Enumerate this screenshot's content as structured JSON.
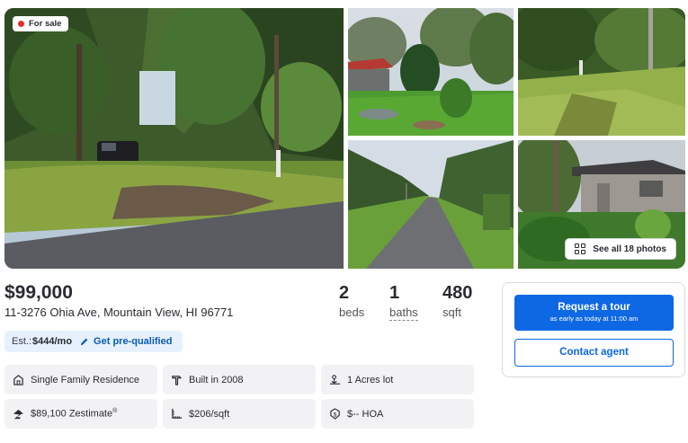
{
  "listing": {
    "status_badge": "For sale",
    "see_all_photos": "See all 18 photos",
    "price": "$99,000",
    "address": "11-3276 Ohia Ave, Mountain View, HI 96771",
    "beds": {
      "value": "2",
      "label": "beds"
    },
    "baths": {
      "value": "1",
      "label": "baths"
    },
    "sqft": {
      "value": "480",
      "label": "sqft"
    }
  },
  "estimate": {
    "prefix": "Est.:",
    "monthly": "$444/mo",
    "prequal_label": "Get pre-qualified"
  },
  "facts": [
    {
      "icon": "house-icon",
      "text": "Single Family Residence"
    },
    {
      "icon": "hammer-icon",
      "text": "Built in 2008"
    },
    {
      "icon": "lot-icon",
      "text": "1 Acres lot"
    },
    {
      "icon": "zestimate-icon",
      "text": "$89,100 Zestimate",
      "sup": "®"
    },
    {
      "icon": "ruler-icon",
      "text": "$206/sqft"
    },
    {
      "icon": "hoa-icon",
      "text": "$-- HOA"
    }
  ],
  "agent_card": {
    "tour_label": "Request a tour",
    "tour_sublabel": "as early as today at 11:00 am",
    "contact_label": "Contact agent"
  },
  "colors": {
    "primary": "#0e68e3",
    "sale_dot": "#e0302c",
    "pill_bg": "#e6f1fd",
    "tile_bg": "#f2f2f5"
  }
}
